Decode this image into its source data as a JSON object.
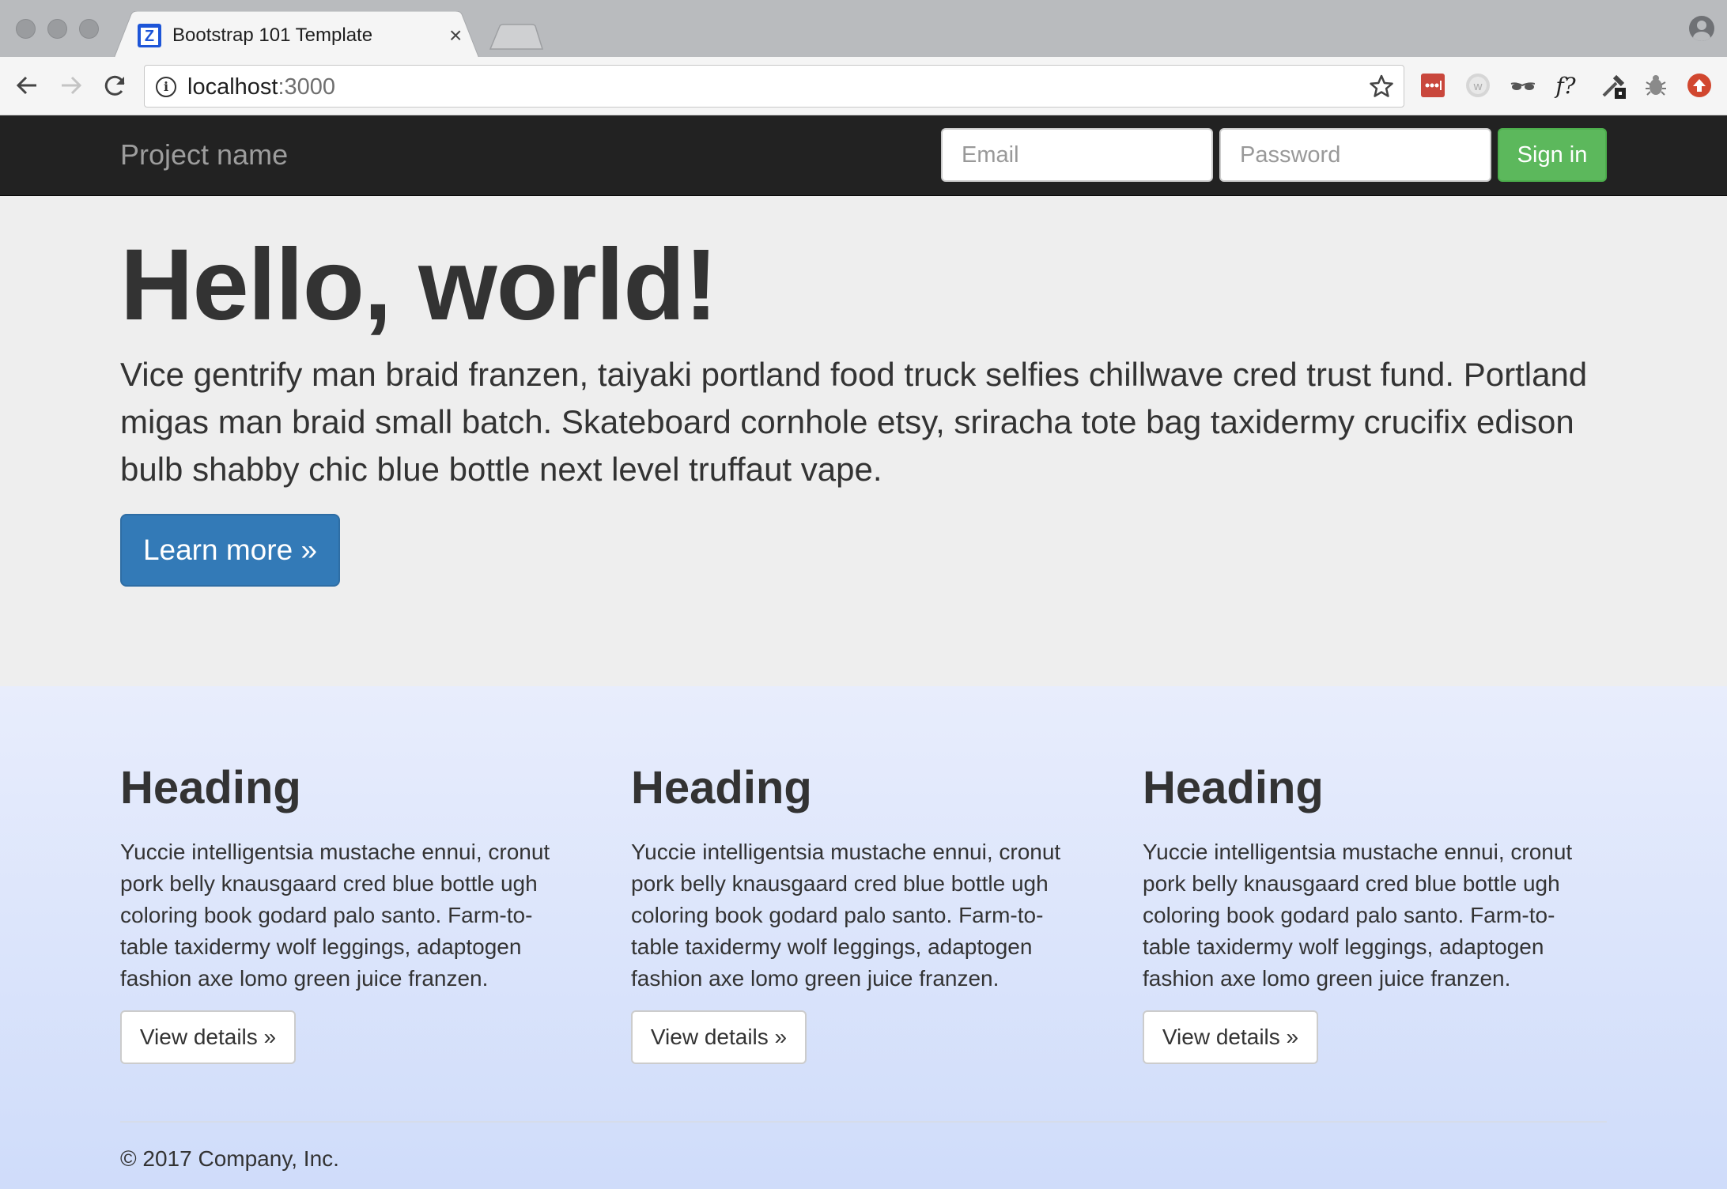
{
  "browser": {
    "tab": {
      "title": "Bootstrap 101 Template",
      "favicon_letter": "Z",
      "favicon_color": "#1d55d8",
      "close_glyph": "×"
    },
    "omnibox": {
      "host": "localhost",
      "port": ":3000"
    },
    "extensions": [
      {
        "name": "lastpass-icon",
        "color": "#c9473c"
      },
      {
        "name": "wappalyzer-icon",
        "color": "#cccccc"
      },
      {
        "name": "glasses-icon",
        "color": "#555555"
      },
      {
        "name": "font-identifier-icon",
        "glyph": "f?"
      },
      {
        "name": "eyedropper-icon",
        "color": "#444444"
      },
      {
        "name": "bug-icon",
        "color": "#777777"
      },
      {
        "name": "upload-icon",
        "color": "#d1472f"
      }
    ]
  },
  "navbar": {
    "brand": "Project name",
    "email_placeholder": "Email",
    "password_placeholder": "Password",
    "signin_label": "Sign in",
    "background": "#222222",
    "signin_color": "#5cb85c"
  },
  "jumbotron": {
    "title": "Hello, world!",
    "text": "Vice gentrify man braid franzen, taiyaki portland food truck selfies chillwave cred trust fund. Portland migas man braid small batch. Skateboard cornhole etsy, sriracha tote bag taxidermy crucifix edison bulb shabby chic blue bottle next level truffaut vape.",
    "button_label": "Learn more »",
    "button_color": "#337ab7"
  },
  "columns": [
    {
      "heading": "Heading",
      "text": "Yuccie intelligentsia mustache ennui, cronut pork belly knausgaard cred blue bottle ugh coloring book godard palo santo. Farm-to-table taxidermy wolf leggings, adaptogen fashion axe lomo green juice franzen.",
      "button_label": "View details »"
    },
    {
      "heading": "Heading",
      "text": "Yuccie intelligentsia mustache ennui, cronut pork belly knausgaard cred blue bottle ugh coloring book godard palo santo. Farm-to-table taxidermy wolf leggings, adaptogen fashion axe lomo green juice franzen.",
      "button_label": "View details »"
    },
    {
      "heading": "Heading",
      "text": "Yuccie intelligentsia mustache ennui, cronut pork belly knausgaard cred blue bottle ugh coloring book godard palo santo. Farm-to-table taxidermy wolf leggings, adaptogen fashion axe lomo green juice franzen.",
      "button_label": "View details »"
    }
  ],
  "footer": {
    "text": "© 2017 Company, Inc."
  }
}
